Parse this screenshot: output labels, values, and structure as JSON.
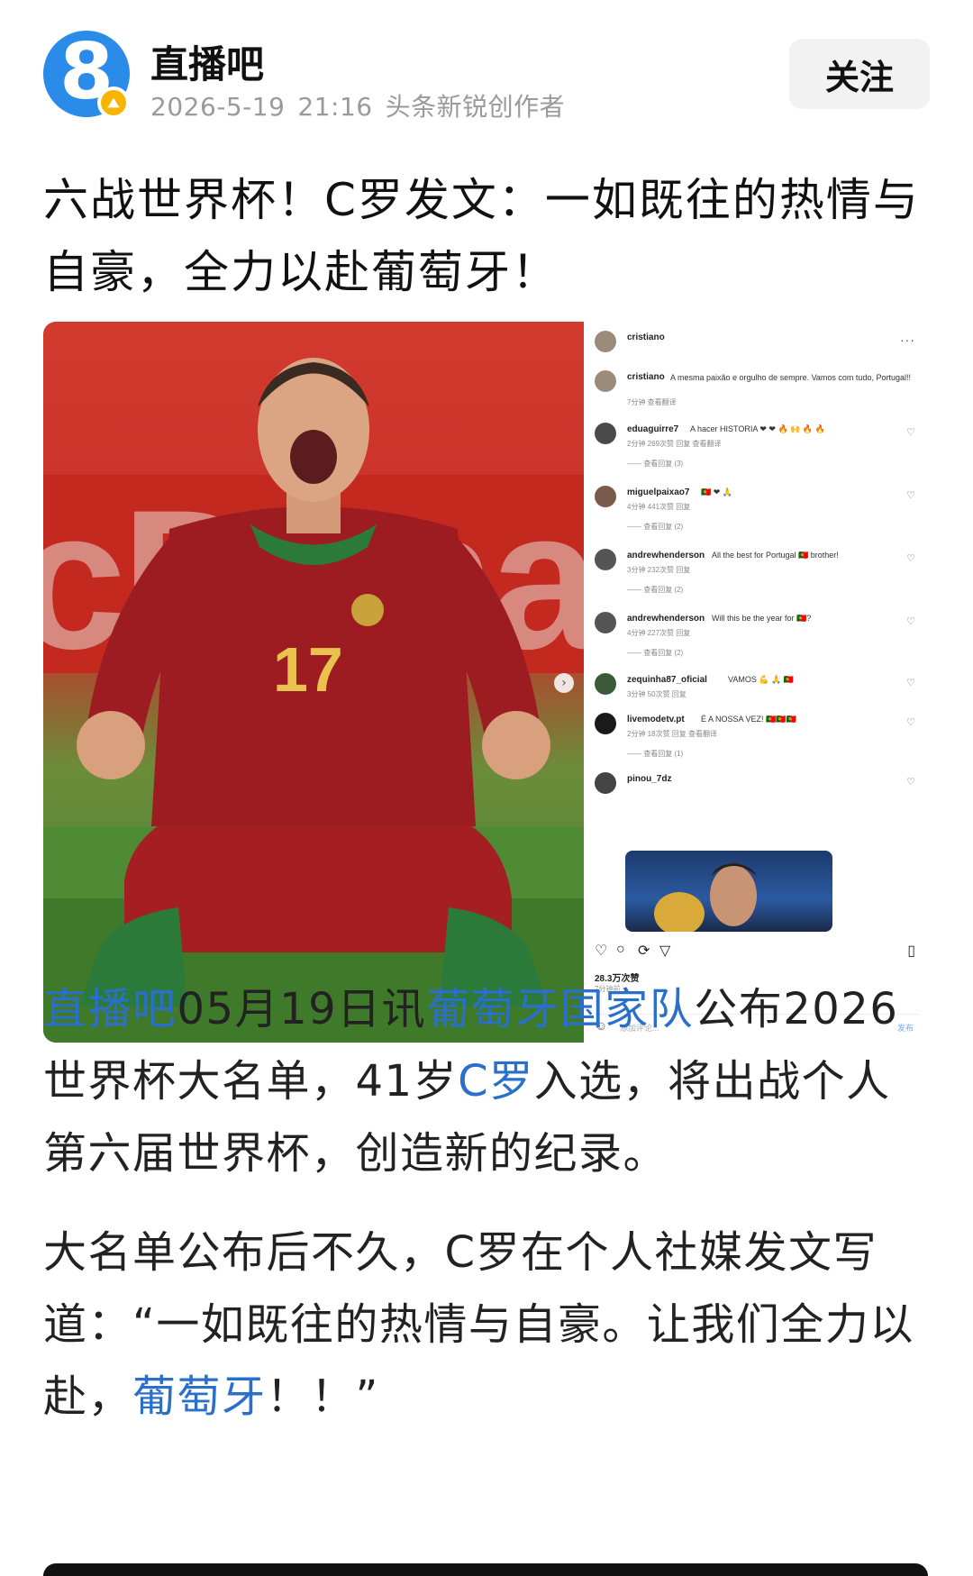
{
  "header": {
    "author": "直播吧",
    "date": "2026-5-19",
    "time": "21:16",
    "author_tag": "头条新锐创作者",
    "follow_label": "关注",
    "avatar_digit": "8"
  },
  "article": {
    "title": "六战世界杯！C罗发文：一如既往的热情与自豪，全力以赴葡萄牙！",
    "paragraph1": [
      {
        "text": "直播吧",
        "link": true
      },
      {
        "text": "05月19日讯",
        "link": false
      },
      {
        "text": "葡萄牙国家队",
        "link": true
      },
      {
        "text": "公布2026世界杯大名单，41岁",
        "link": false
      },
      {
        "text": "C罗",
        "link": true
      },
      {
        "text": "入选，将出战个人第六届世界杯，创造新的纪录。",
        "link": false
      }
    ],
    "paragraph2": [
      {
        "text": "大名单公布后不久，C罗在个人社媒发文写道：“一如既往的热情与自豪。让我们全力以赴，",
        "link": false
      },
      {
        "text": "葡萄牙",
        "link": true
      },
      {
        "text": "！！”",
        "link": false
      }
    ]
  },
  "image": {
    "banner_text": "cDona",
    "jersey_number": "17",
    "instagram": {
      "header_user": "cristiano",
      "post": {
        "user": "cristiano",
        "text": "A mesma paixão e orgulho de sempre. Vamos com tudo, Portugal!!",
        "sub": "7分钟  查看翻译"
      },
      "comments": [
        {
          "user": "eduaguirre7",
          "text": "A hacer HISTORIA ❤ ❤ 🔥 🙌 🔥 🔥",
          "sub": "2分钟  269次赞  回复  查看翻译",
          "more": "查看回复 (3)"
        },
        {
          "user": "miguelpaixao7",
          "text": "🇵🇹 ❤ 🙏",
          "sub": "4分钟  441次赞  回复",
          "more": "查看回复 (2)"
        },
        {
          "user": "andrewhenderson",
          "text": "All the best for Portugal 🇵🇹 brother!",
          "sub": "3分钟  232次赞  回复",
          "more": "查看回复 (2)"
        },
        {
          "user": "andrewhenderson",
          "text": "Will this be the year for 🇵🇹?",
          "sub": "4分钟  227次赞  回复",
          "more": "查看回复 (2)"
        },
        {
          "user": "zequinha87_oficial",
          "text": "VAMOS 💪 🙏 🇵🇹",
          "sub": "3分钟  50次赞  回复",
          "more": ""
        },
        {
          "user": "livemodetv.pt",
          "text": "É A NOSSA VEZ! 🇵🇹🇵🇹🇵🇹",
          "sub": "2分钟  18次赞  回复  查看翻译",
          "more": "查看回复 (1)"
        },
        {
          "user": "pinou_7dz",
          "text": "",
          "sub": "",
          "more": ""
        }
      ],
      "likes": "28.3万次赞",
      "time": "7分钟前",
      "comment_placeholder": "添加评论...",
      "post_label": "发布"
    }
  },
  "colors": {
    "link": "#2a6fc9",
    "avatar_bg": "#2b8be8",
    "badge": "#f7b500",
    "meta_gray": "#9a9a9a"
  },
  "icons": {
    "avatar": "channel-8-logo",
    "badge": "verified-badge-icon",
    "like": "heart-icon",
    "comment": "comment-icon",
    "share": "share-icon",
    "send": "send-icon",
    "save": "bookmark-icon",
    "more": "more-dots-icon",
    "next": "chevron-right-icon"
  }
}
